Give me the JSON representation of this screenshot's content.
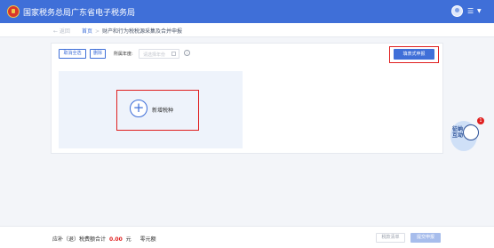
{
  "header": {
    "title": "国家税务总局广东省电子税务局",
    "menu_icon": "menu-icon",
    "caret_icon": "caret-down-icon"
  },
  "breadcrumb": {
    "back_label": "← 返回",
    "home": "首页",
    "separator": ">",
    "current": "财产和行为税税源采集及合并申报"
  },
  "toolbar": {
    "batch_label": "取消全选",
    "delete_label": "删除",
    "year_label": "所属年度:",
    "year_placeholder": "请选择年份",
    "info_icon": "i",
    "primary_label": "填表式申报"
  },
  "add_card": {
    "plus": "+",
    "label": "新增税种"
  },
  "mascot": {
    "text": "征纳互动",
    "badge": "1"
  },
  "footer": {
    "summary_label": "应补（退）税费额合计",
    "amount": "0.00",
    "unit": "元",
    "extra": "零元额",
    "view_label": "税款清单",
    "submit_label": "提交申报"
  },
  "colors": {
    "brand": "#3f6fd8",
    "highlight": "#e02020",
    "amount": "#e02020"
  }
}
